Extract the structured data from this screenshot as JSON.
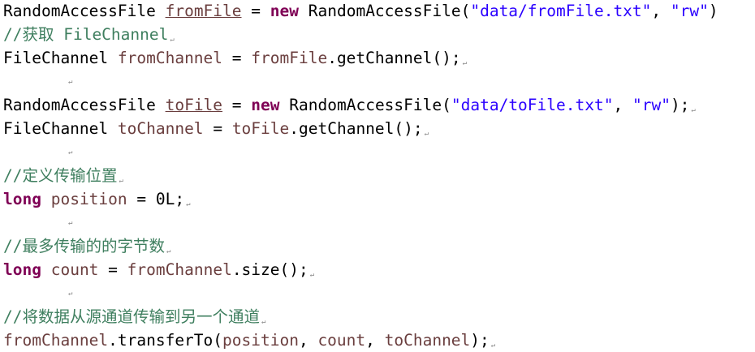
{
  "paragraph_mark": "↵",
  "lines": {
    "l1": {
      "type": "RandomAccessFile",
      "var": "fromFile",
      "eq": "=",
      "kw": "new",
      "ctor": "RandomAccessFile(",
      "s1": "\"data/fromFile.txt\"",
      "comma": ",",
      "s2": "\"rw\"",
      "end": ")"
    },
    "l2": {
      "text": "//获取 FileChannel"
    },
    "l3": {
      "type": "FileChannel",
      "var": "fromChannel",
      "eq": "=",
      "ref": "fromFile",
      "call": ".getChannel();"
    },
    "l5": {
      "type": "RandomAccessFile",
      "var": "toFile",
      "eq": "=",
      "kw": "new",
      "ctor": "RandomAccessFile(",
      "s1": "\"data/toFile.txt\"",
      "comma": ",",
      "s2": "\"rw\"",
      "end": ");"
    },
    "l6": {
      "type": "FileChannel",
      "var": "toChannel",
      "eq": "=",
      "ref": "toFile",
      "call": ".getChannel();"
    },
    "l8": {
      "text": "//定义传输位置"
    },
    "l9": {
      "kw": "long",
      "var": "position",
      "eq": "=",
      "val": "0L;"
    },
    "l11": {
      "text": "//最多传输的的字节数"
    },
    "l12": {
      "kw": "long",
      "var": "count",
      "eq": "=",
      "ref": "fromChannel",
      "call": ".size();"
    },
    "l14": {
      "text": "//将数据从源通道传输到另一个通道"
    },
    "l15": {
      "ref": "fromChannel",
      "call": ".transferTo(",
      "a1": "position",
      "c1": ", ",
      "a2": "count",
      "c2": ", ",
      "a3": "toChannel",
      "end": ");"
    }
  }
}
